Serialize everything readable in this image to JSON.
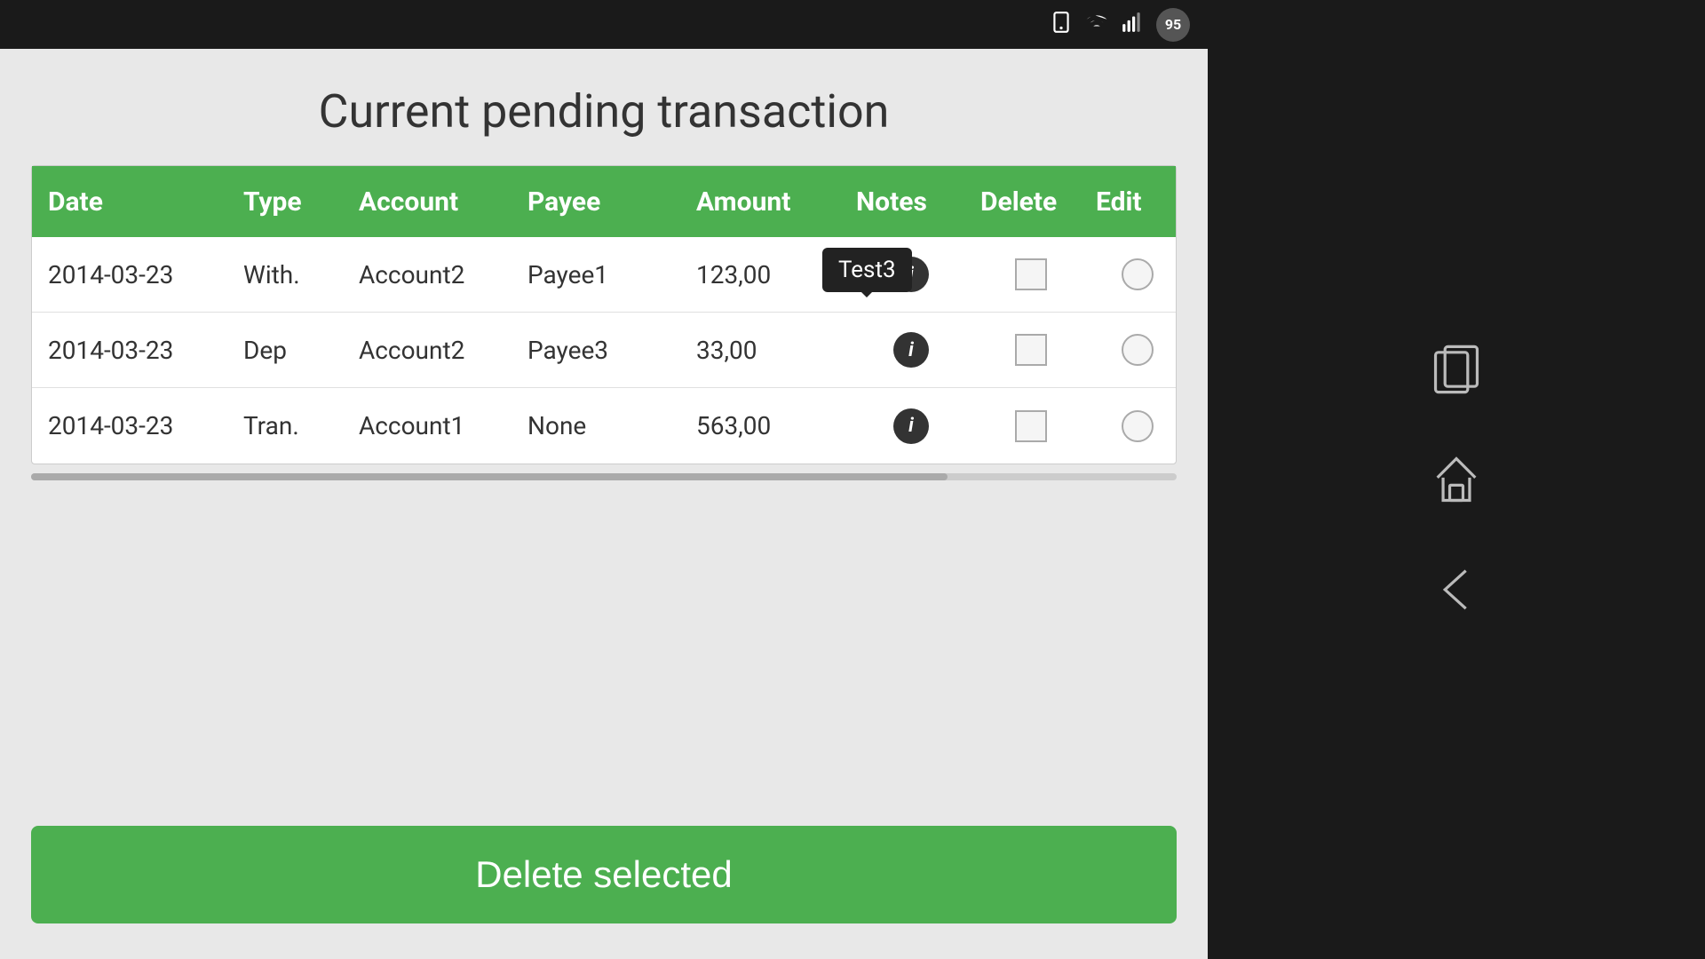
{
  "statusBar": {
    "battery": "95"
  },
  "pageTitle": "Current pending transaction",
  "table": {
    "headers": [
      "Date",
      "Type",
      "Account",
      "Payee",
      "Amount",
      "Notes",
      "Delete",
      "Edit"
    ],
    "rows": [
      {
        "date": "2014-03-23",
        "type": "With.",
        "account": "Account2",
        "payee": "Payee1",
        "amount": "123,00",
        "note": "i",
        "tooltip": "Test3"
      },
      {
        "date": "2014-03-23",
        "type": "Dep",
        "account": "Account2",
        "payee": "Payee3",
        "amount": "33,00",
        "note": "i",
        "tooltip": null
      },
      {
        "date": "2014-03-23",
        "type": "Tran.",
        "account": "Account1",
        "payee": "None",
        "amount": "563,00",
        "note": "i",
        "tooltip": null
      }
    ]
  },
  "deleteButton": {
    "label": "Delete selected"
  }
}
